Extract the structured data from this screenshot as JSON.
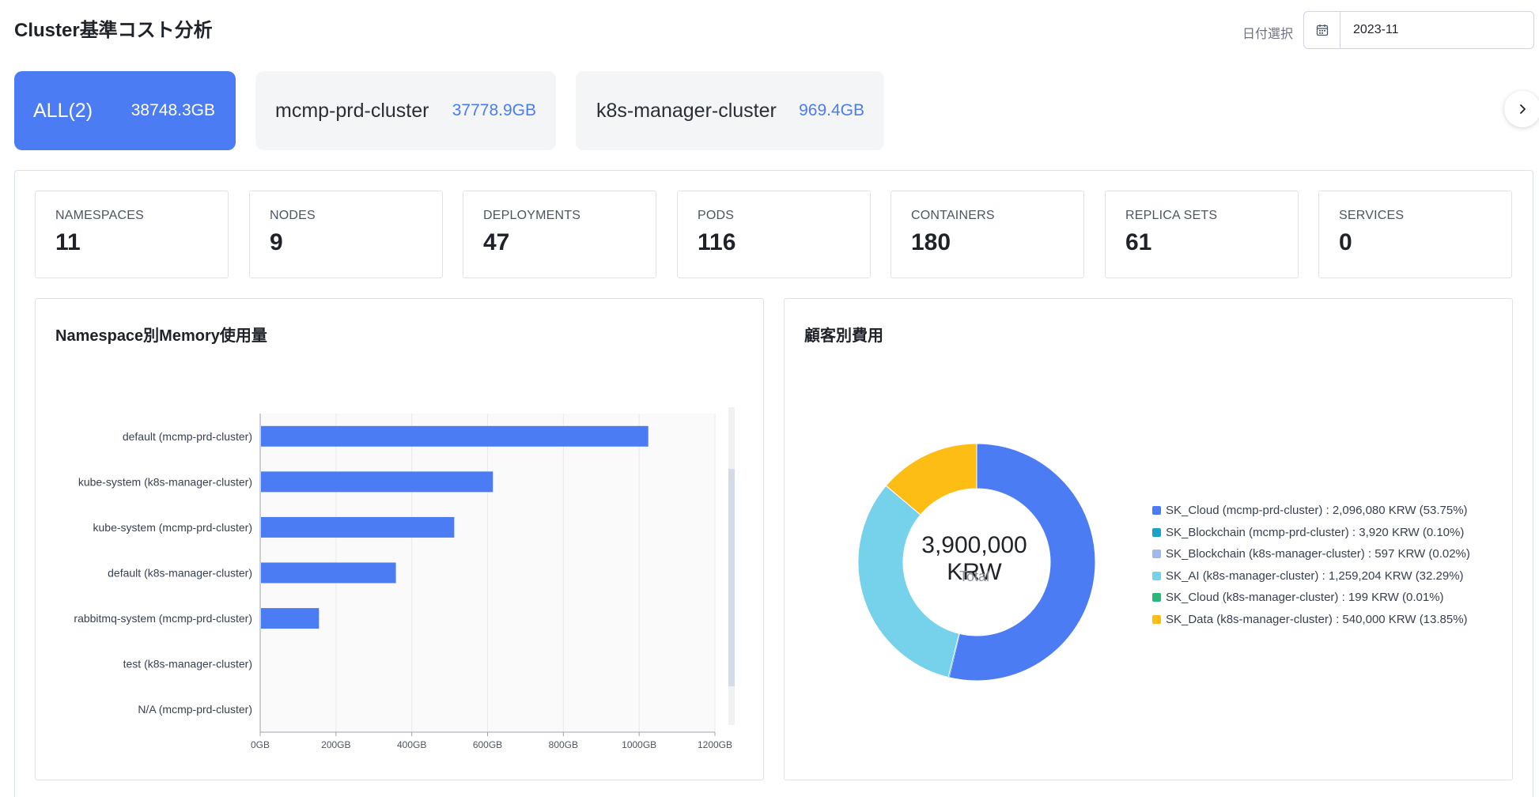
{
  "page": {
    "title": "Cluster基準コスト分析"
  },
  "date_filter": {
    "label": "日付選択",
    "value": "2023-11"
  },
  "clusters": [
    {
      "name": "ALL(2)",
      "size": "38748.3GB",
      "active": true
    },
    {
      "name": "mcmp-prd-cluster",
      "size": "37778.9GB",
      "active": false
    },
    {
      "name": "k8s-manager-cluster",
      "size": "969.4GB",
      "active": false
    }
  ],
  "stats": [
    {
      "label": "NAMESPACES",
      "value": "11"
    },
    {
      "label": "NODES",
      "value": "9"
    },
    {
      "label": "DEPLOYMENTS",
      "value": "47"
    },
    {
      "label": "PODS",
      "value": "116"
    },
    {
      "label": "CONTAINERS",
      "value": "180"
    },
    {
      "label": "REPLICA SETS",
      "value": "61"
    },
    {
      "label": "SERVICES",
      "value": "0"
    }
  ],
  "memory_card": {
    "title": "Namespace別Memory使用量"
  },
  "cost_card": {
    "title": "顧客別費用",
    "total": "3,900,000 KRW",
    "total_label": "Total"
  },
  "icons": {
    "date": "calendar-icon",
    "next": "chevron-right-icon"
  },
  "colors": {
    "accent": "#4b7cf3",
    "bar": "#4b7cf3"
  },
  "chart_data": [
    {
      "type": "bar",
      "orientation": "horizontal",
      "categories": [
        "default (mcmp-prd-cluster)",
        "kube-system (k8s-manager-cluster)",
        "kube-system (mcmp-prd-cluster)",
        "default (k8s-manager-cluster)",
        "rabbitmq-system (mcmp-prd-cluster)",
        "test (k8s-manager-cluster)",
        "N/A (mcmp-prd-cluster)"
      ],
      "values": [
        1022,
        612,
        510,
        356,
        153,
        0,
        0
      ],
      "xlim": [
        0,
        1200
      ],
      "x_ticks": [
        "0GB",
        "200GB",
        "400GB",
        "600GB",
        "800GB",
        "1000GB",
        "1200GB"
      ],
      "grid": true
    },
    {
      "type": "pie",
      "donut": true,
      "slices": [
        {
          "label": "SK_Cloud (mcmp-prd-cluster) : 2,096,080 KRW (53.75%)",
          "value": 53.75,
          "color": "#4b7cf3"
        },
        {
          "label": "SK_Blockchain (mcmp-prd-cluster) : 3,920 KRW (0.10%)",
          "value": 0.1,
          "color": "#1aa3c9"
        },
        {
          "label": "SK_Blockchain (k8s-manager-cluster) : 597 KRW (0.02%)",
          "value": 0.02,
          "color": "#9fb8f0"
        },
        {
          "label": "SK_AI (k8s-manager-cluster) : 1,259,204 KRW (32.29%)",
          "value": 32.29,
          "color": "#76d1ea"
        },
        {
          "label": "SK_Cloud (k8s-manager-cluster) : 199 KRW (0.01%)",
          "value": 0.01,
          "color": "#2ab77a"
        },
        {
          "label": "SK_Data (k8s-manager-cluster) : 540,000 KRW (13.85%)",
          "value": 13.85,
          "color": "#fdbd14"
        }
      ],
      "legend": "right"
    }
  ]
}
